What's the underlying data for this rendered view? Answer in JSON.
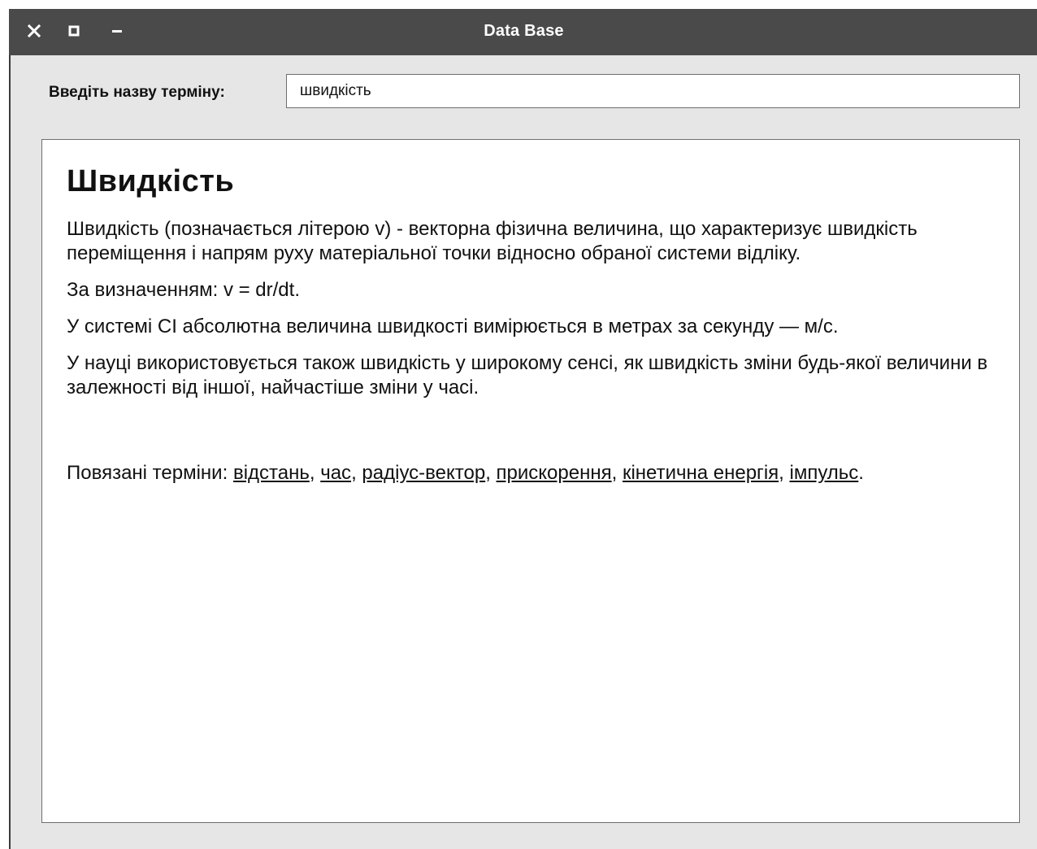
{
  "window": {
    "title": "Data Base",
    "controls": {
      "close_icon": "close-icon",
      "maximize_icon": "maximize-icon",
      "minimize_icon": "minimize-icon"
    }
  },
  "search": {
    "label": "Введіть назву терміну:",
    "value": "швидкість"
  },
  "article": {
    "heading": "Швидкість",
    "paragraphs": [
      "Швидкість (позначається літерою v) - векторна фізична величина, що характеризує швидкість переміщення і напрям руху матеріальної точки відносно обраної системи відліку.",
      "За визначенням: v = dr/dt.",
      "У системі СІ абсолютна величина швидкості вимірюється в метрах за секунду — м/с.",
      "У науці використовується також швидкість у широкому сенсі, як швидкість зміни будь-якої величини в залежності від іншої, найчастіше зміни у часі."
    ],
    "related": {
      "prefix": "Повязані терміни: ",
      "links": [
        "відстань",
        "час",
        "радіус-вектор",
        "прискорення",
        "кінетична енергія",
        "імпульс"
      ],
      "separator": ", ",
      "suffix": "."
    }
  },
  "colors": {
    "titlebar": "#4a4a4a",
    "window_bg": "#e6e6e6",
    "content_bg": "#ffffff"
  }
}
